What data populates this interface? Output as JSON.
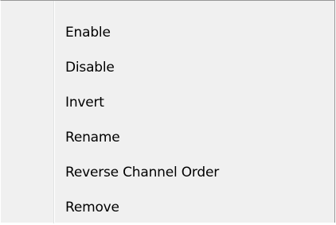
{
  "context_menu": {
    "items": [
      {
        "label": "Enable"
      },
      {
        "label": "Disable"
      },
      {
        "label": "Invert"
      },
      {
        "label": "Rename"
      },
      {
        "label": "Reverse Channel Order"
      },
      {
        "label": "Remove"
      }
    ]
  },
  "colors": {
    "menu_background": "#f0f0f0",
    "menu_border": "#979797",
    "gutter_separator": "#e2e3e3",
    "text": "#000000"
  }
}
